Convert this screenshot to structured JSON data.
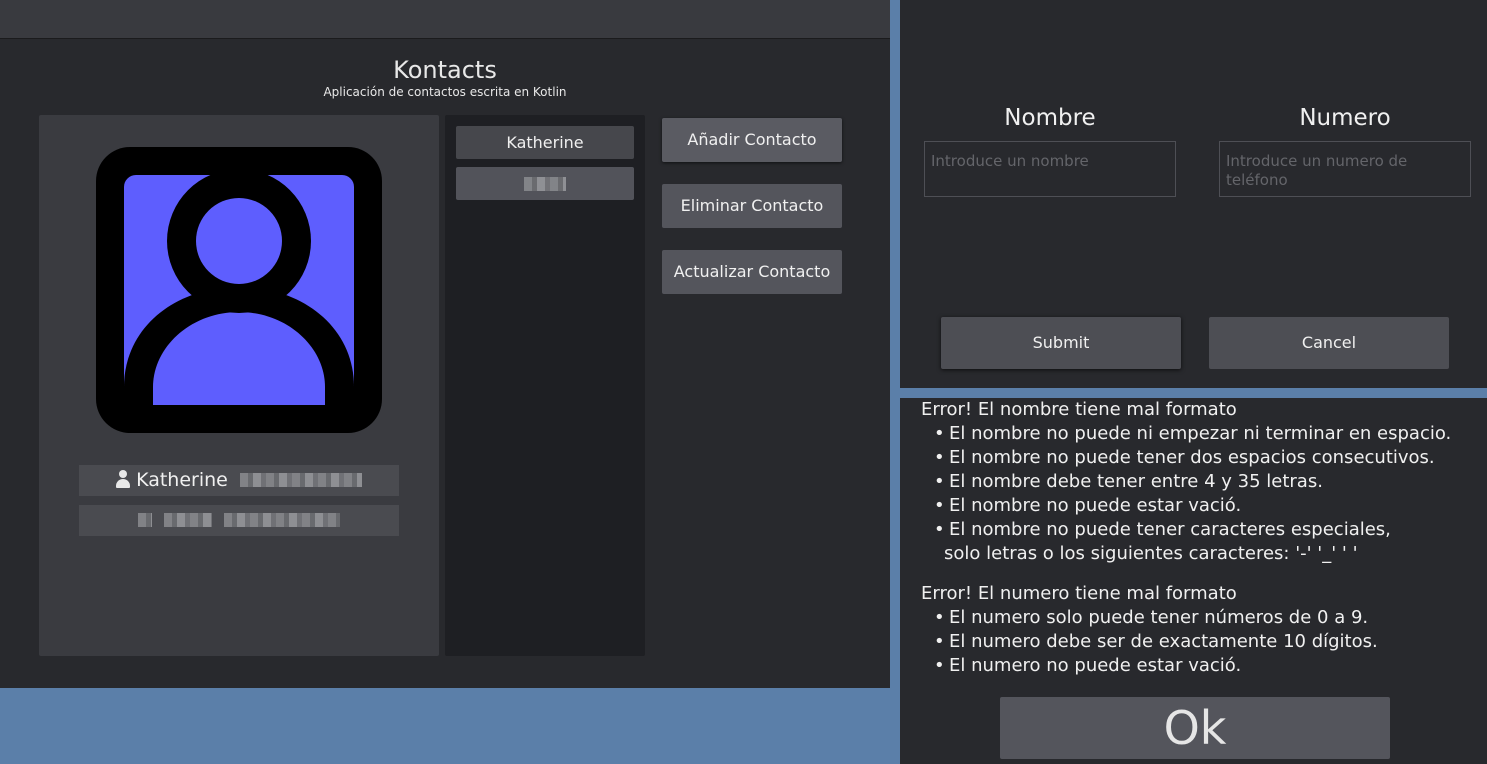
{
  "main_window": {
    "title": "Kontacts",
    "subtitle": "Aplicación de contactos escrita en Kotlin",
    "avatar": {
      "icon": "person-avatar-icon",
      "color": "#5e5efe"
    },
    "selected_contact": {
      "name": "Katherine",
      "name_icon": "person-icon"
    },
    "contacts": [
      {
        "name": "Katherine"
      },
      {
        "name": ""
      }
    ],
    "buttons": {
      "add": "Añadir Contacto",
      "delete": "Eliminar Contacto",
      "update": "Actualizar Contacto"
    }
  },
  "form_dialog": {
    "name_label": "Nombre",
    "name_placeholder": "Introduce un nombre",
    "number_label": "Numero",
    "number_placeholder": "Introduce un numero de teléfono",
    "submit": "Submit",
    "cancel": "Cancel"
  },
  "error_dialog": {
    "name_error_title": "Error! El nombre tiene mal formato",
    "name_errors": [
      "El nombre no puede ni empezar ni terminar en espacio.",
      "El nombre no puede tener dos espacios consecutivos.",
      "El nombre debe tener entre 4 y 35 letras.",
      "El nombre no puede estar vació.",
      "El nombre no puede tener caracteres especiales,"
    ],
    "name_errors_continuation": "solo letras o los siguientes caracteres: '-' '_' ' '",
    "number_error_title": "Error! El numero tiene mal formato",
    "number_errors": [
      "El numero solo puede tener números de 0 a 9.",
      "El numero debe ser de exactamente 10 dígitos.",
      "El numero no puede estar vació."
    ],
    "ok": "Ok"
  },
  "colors": {
    "desktop": "#5b7fa9",
    "window_bg": "#28292d",
    "card_bg": "#3a3b40",
    "button_bg": "#54555c",
    "avatar_fill": "#5e5efe"
  }
}
